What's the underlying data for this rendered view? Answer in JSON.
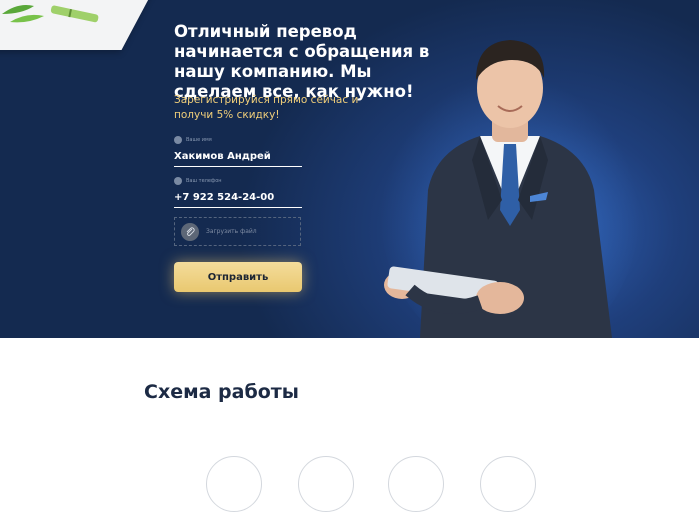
{
  "hero": {
    "headline": "Отличный перевод начинается с обращения в нашу компанию. Мы сделаем все, как нужно!",
    "promo": "Зарегистрируйся прямо сейчас и получи 5% скидку!",
    "name_field": {
      "label": "Ваше имя",
      "value": "Хакимов Андрей",
      "icon": "user-icon"
    },
    "phone_field": {
      "label": "Ваш телефон",
      "value": "+7 922 524-24-00",
      "icon": "phone-icon"
    },
    "upload": {
      "label": "Загрузить файл",
      "icon": "paperclip-icon"
    },
    "submit_label": "Отправить"
  },
  "work_scheme": {
    "title": "Схема работы"
  },
  "colors": {
    "hero_bg": "#142a50",
    "accent_gold": "#f1cf7a",
    "button": "#efd387",
    "title_dark": "#1c2a44"
  }
}
